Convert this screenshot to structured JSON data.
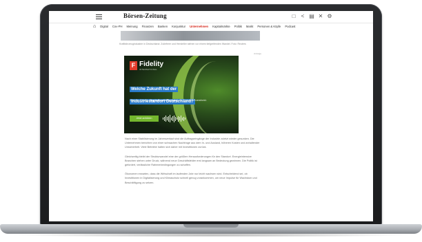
{
  "header": {
    "brand": "Börsen-Zeitung",
    "toolbar_icons": [
      "bookmark-icon",
      "share-icon",
      "print-icon",
      "close-icon",
      "settings-icon"
    ]
  },
  "nav": {
    "items": [
      {
        "label": "Digital",
        "active": false
      },
      {
        "label": "Cov-PH",
        "active": false
      },
      {
        "label": "Meinung",
        "active": false
      },
      {
        "label": "Finanzen",
        "active": false
      },
      {
        "label": "Banken",
        "active": false
      },
      {
        "label": "Konjunktur",
        "active": false
      },
      {
        "label": "Unternehmen",
        "active": true
      },
      {
        "label": "Kapitalmärkte",
        "active": false
      },
      {
        "label": "Politik",
        "active": false
      },
      {
        "label": "Markt",
        "active": false
      },
      {
        "label": "Personen & Köpfe",
        "active": false
      },
      {
        "label": "Podcast",
        "active": false
      }
    ]
  },
  "article": {
    "caption": "Kraftfahrzeugindustrie in Deutschland: Zulieferer und Hersteller stehen vor einem tiefgreifenden Wandel. Foto: Reuters",
    "ad_tag": "Anzeige",
    "paragraphs": [
      "Nach einer Stabilisierung im Jahresverlauf sind die Auftragseingänge der Industrie zuletzt wieder gesunken. Die Unternehmen berichten von einer schwachen Nachfrage aus dem In- und Ausland, höheren Kosten und anhaltender Unsicherheit. Viele Betriebe halten sich daher mit Investitionen zurück.",
      "Gleichzeitig bleibt der Strukturwandel eine der größten Herausforderungen für den Standort. Energieintensive Branchen stehen unter Druck, während neue Geschäftsfelder erst langsam an Bedeutung gewinnen. Die Politik ist gefordert, verlässliche Rahmenbedingungen zu schaffen.",
      "Ökonomen erwarten, dass die Wirtschaft im laufenden Jahr nur leicht wachsen wird. Entscheidend sei, ob Investitionen in Digitalisierung und Klimaschutz schnell genug vorankommen, um neue Impulse für Wachstum und Beschäftigung zu setzen."
    ]
  },
  "ad": {
    "logo_letter": "F",
    "brand": "Fidelity",
    "brand_sub": "INTERNATIONAL",
    "headline_lines": [
      "Welche Zukunft hat der",
      "Industriestandort Deutschland?"
    ],
    "body_prefix": "Jetzt im Fidelity ",
    "body_bold": "Kapitalmarkt-Podcast",
    "body_suffix": " mit Carsten Roemheld.",
    "cta": "Jetzt anhören",
    "colors": {
      "accent": "#74b72e",
      "headline_bg": "#2a7ac9",
      "logo_bg": "#e23c2b"
    }
  }
}
